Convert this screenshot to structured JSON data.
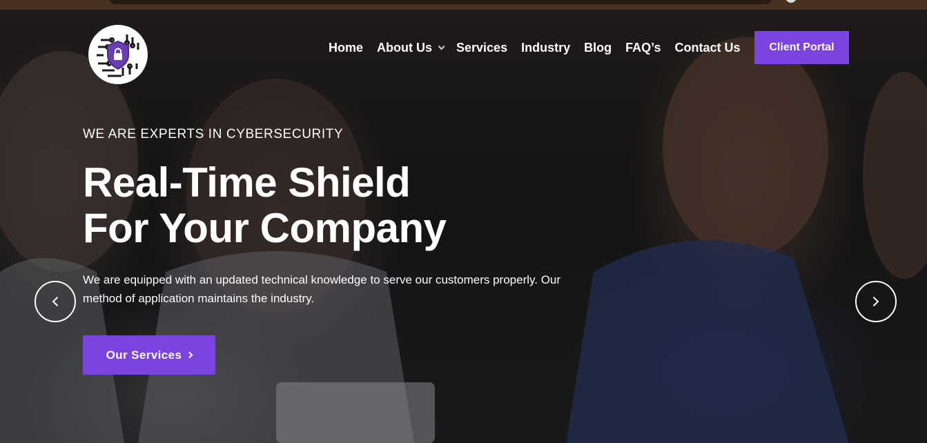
{
  "nav": {
    "items": [
      {
        "label": "Home"
      },
      {
        "label": "About Us",
        "has_dropdown": true
      },
      {
        "label": "Services"
      },
      {
        "label": "Industry"
      },
      {
        "label": "Blog"
      },
      {
        "label": "FAQ’s"
      },
      {
        "label": "Contact Us"
      }
    ],
    "portal_label": "Client Portal"
  },
  "logo": {
    "icon": "shield-lock-icon"
  },
  "hero": {
    "eyebrow": "WE ARE EXPERTS IN CYBERSECURITY",
    "headline_line1": "Real-Time Shield",
    "headline_line2": "For Your Company",
    "description": "We are equipped with an updated technical knowledge to serve our customers properly. Our method of application maintains the industry.",
    "cta_label": "Our Services",
    "prev_icon": "chevron-left-icon",
    "next_icon": "chevron-right-icon"
  },
  "colors": {
    "accent": "#7b43e0",
    "text": "#ffffff",
    "topbar": "#4a3222"
  }
}
